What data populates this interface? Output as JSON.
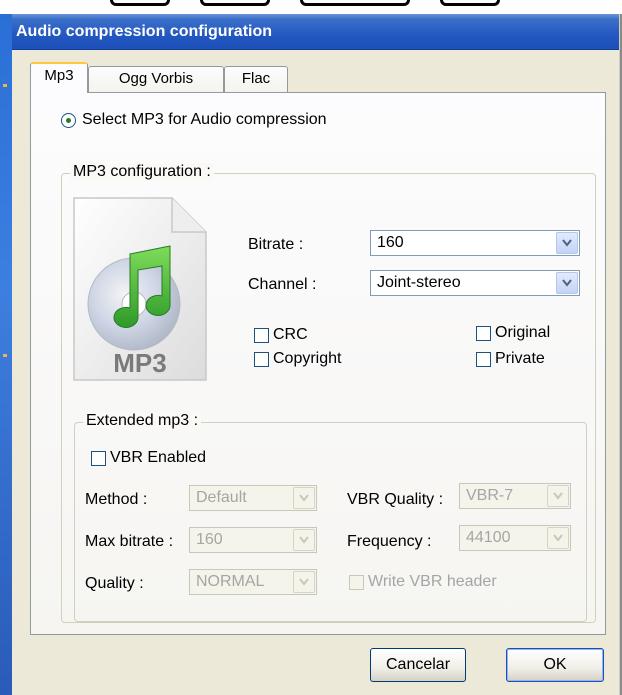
{
  "window": {
    "title": "Audio compression configuration"
  },
  "tabs": [
    {
      "label": "Mp3",
      "active": true
    },
    {
      "label": "Ogg Vorbis",
      "active": false
    },
    {
      "label": "Flac",
      "active": false
    }
  ],
  "mp3_tab": {
    "select_radio_label": "Select MP3 for Audio compression",
    "select_radio_checked": true,
    "config_group": {
      "legend": "MP3 configuration :",
      "icon_text": "MP3",
      "bitrate": {
        "label": "Bitrate :",
        "value": "160"
      },
      "channel": {
        "label": "Channel :",
        "value": "Joint-stereo"
      },
      "checkboxes": {
        "crc": {
          "label": "CRC",
          "checked": false
        },
        "copyright": {
          "label": "Copyright",
          "checked": false
        },
        "original": {
          "label": "Original",
          "checked": false
        },
        "private": {
          "label": "Private",
          "checked": false
        }
      }
    },
    "extended_group": {
      "legend": "Extended mp3 :",
      "vbr_enabled": {
        "label": "VBR Enabled",
        "checked": false
      },
      "method": {
        "label": "Method :",
        "value": "Default"
      },
      "max_bitrate": {
        "label": "Max bitrate :",
        "value": "160"
      },
      "quality": {
        "label": "Quality :",
        "value": "NORMAL"
      },
      "vbr_quality": {
        "label": "VBR Quality :",
        "value": "VBR-7"
      },
      "frequency": {
        "label": "Frequency :",
        "value": "44100"
      },
      "write_vbr_header": {
        "label": "Write VBR header",
        "checked": false
      }
    }
  },
  "buttons": {
    "cancel": "Cancelar",
    "ok": "OK"
  },
  "colors": {
    "titlebar": "#2458c1",
    "panel_bg": "#fcfcfe",
    "disabled_text": "#a5a5a5",
    "icon_note_green": "#3cb034"
  }
}
